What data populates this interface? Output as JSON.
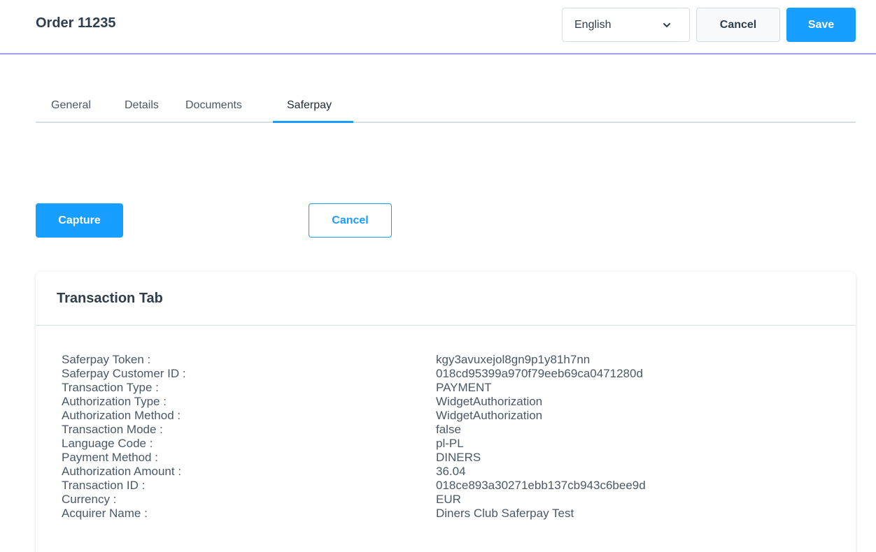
{
  "header": {
    "title": "Order 11235",
    "language": "English",
    "cancel_label": "Cancel",
    "save_label": "Save"
  },
  "tabs": [
    {
      "label": "General"
    },
    {
      "label": "Details"
    },
    {
      "label": "Documents"
    },
    {
      "label": "Saferpay",
      "active": true
    }
  ],
  "actions": {
    "capture_label": "Capture",
    "cancel_label": "Cancel"
  },
  "card": {
    "title": "Transaction Tab",
    "rows": [
      {
        "label": "Saferpay Token :",
        "value": "kgy3avuxejol8gn9p1y81h7nn"
      },
      {
        "label": "Saferpay Customer ID :",
        "value": "018cd95399a970f79eeb69ca0471280d"
      },
      {
        "label": "Transaction Type :",
        "value": "PAYMENT"
      },
      {
        "label": "Authorization Type :",
        "value": "WidgetAuthorization"
      },
      {
        "label": "Authorization Method :",
        "value": "WidgetAuthorization"
      },
      {
        "label": "Transaction Mode :",
        "value": "false"
      },
      {
        "label": "Language Code :",
        "value": "pl-PL"
      },
      {
        "label": "Payment Method :",
        "value": "DINERS"
      },
      {
        "label": "Authorization Amount :",
        "value": "36.04"
      },
      {
        "label": "Transaction ID :",
        "value": "018ce893a30271ebb137cb943c6bee9d"
      },
      {
        "label": "Currency :",
        "value": "EUR"
      },
      {
        "label": "Acquirer Name :",
        "value": "Diners Club Saferpay Test"
      }
    ]
  },
  "colors": {
    "primary": "#189eff",
    "header_border": "#a59df0",
    "text": "#4a5866"
  },
  "icons": {
    "language_dropdown": "chevron-down-icon"
  }
}
